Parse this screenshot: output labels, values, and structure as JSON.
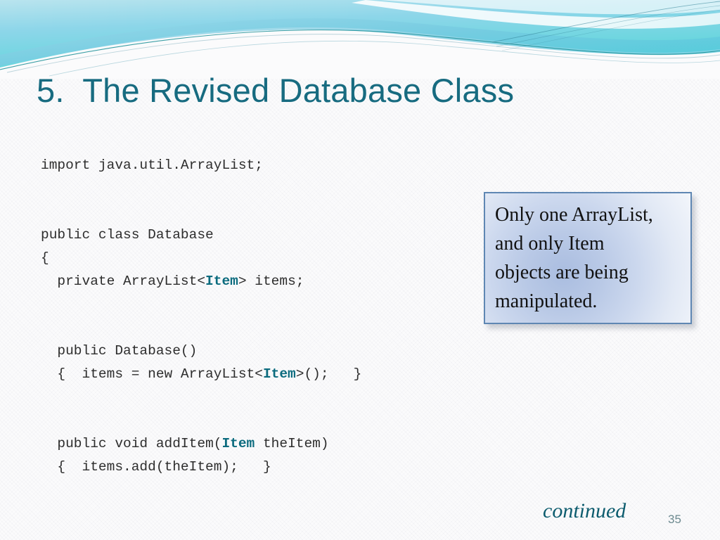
{
  "slide": {
    "title": "5.  The Revised Database Class",
    "title_color": "#176b80",
    "background_color": "#fbfbfc"
  },
  "header": {
    "name": "decorative-wave-banner",
    "gradient_from": "#9ad8ea",
    "gradient_to": "#56d6d4",
    "accent_line_color": "#10868f"
  },
  "code": {
    "font_color": "#2d2d2d",
    "keyword_color": "#0b6b7e",
    "lines": [
      {
        "id": "l1",
        "segments": [
          {
            "text": "import java.util.ArrayList;",
            "kind": "plain"
          }
        ]
      },
      {
        "id": "l2",
        "segments": [
          {
            "text": "",
            "kind": "plain"
          }
        ]
      },
      {
        "id": "l3",
        "segments": [
          {
            "text": "",
            "kind": "plain"
          }
        ]
      },
      {
        "id": "l4",
        "segments": [
          {
            "text": "public class Database",
            "kind": "plain"
          }
        ]
      },
      {
        "id": "l5",
        "segments": [
          {
            "text": "{",
            "kind": "plain"
          }
        ]
      },
      {
        "id": "l6",
        "segments": [
          {
            "text": "  private ArrayList<",
            "kind": "plain"
          },
          {
            "text": "Item",
            "kind": "keyword"
          },
          {
            "text": "> items;",
            "kind": "plain"
          }
        ]
      },
      {
        "id": "l7",
        "segments": [
          {
            "text": "",
            "kind": "plain"
          }
        ]
      },
      {
        "id": "l8",
        "segments": [
          {
            "text": "",
            "kind": "plain"
          }
        ]
      },
      {
        "id": "l9",
        "segments": [
          {
            "text": "  public Database()",
            "kind": "plain"
          }
        ]
      },
      {
        "id": "l10",
        "segments": [
          {
            "text": "  {  items = new ArrayList<",
            "kind": "plain"
          },
          {
            "text": "Item",
            "kind": "keyword"
          },
          {
            "text": ">();   }",
            "kind": "plain"
          }
        ]
      },
      {
        "id": "l11",
        "segments": [
          {
            "text": "",
            "kind": "plain"
          }
        ]
      },
      {
        "id": "l12",
        "segments": [
          {
            "text": "",
            "kind": "plain"
          }
        ]
      },
      {
        "id": "l13",
        "segments": [
          {
            "text": "  public void addItem(",
            "kind": "plain"
          },
          {
            "text": "Item",
            "kind": "keyword"
          },
          {
            "text": " theItem)",
            "kind": "plain"
          }
        ]
      },
      {
        "id": "l14",
        "segments": [
          {
            "text": "  {  items.add(theItem);   }",
            "kind": "plain"
          }
        ]
      }
    ]
  },
  "callout": {
    "text": "Only one ArrayList,\nand only Item\nobjects are being\nmanipulated.",
    "border_color": "#5f87b3",
    "fill_color": "#b9c9e6",
    "text_color": "#111111"
  },
  "footer": {
    "continued_label": "continued",
    "continued_color": "#0d5c6e",
    "page_number": "35",
    "page_number_color": "#6d8a90"
  }
}
